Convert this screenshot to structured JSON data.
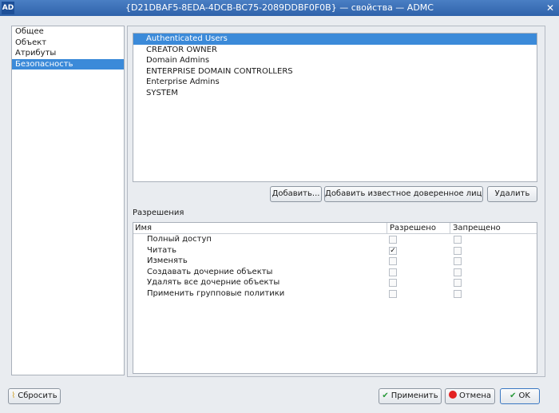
{
  "window": {
    "app_icon": "AD",
    "title": "{D21DBAF5-8EDA-4DCB-BC75-2089DDBF0F0B} — свойства — ADMC",
    "close_glyph": "✕"
  },
  "nav": {
    "items": [
      {
        "label": "Общее"
      },
      {
        "label": "Объект"
      },
      {
        "label": "Атрибуты"
      },
      {
        "label": "Безопасность",
        "selected": true
      }
    ]
  },
  "principals": {
    "items": [
      {
        "label": "Authenticated Users",
        "selected": true
      },
      {
        "label": "CREATOR OWNER"
      },
      {
        "label": "Domain Admins"
      },
      {
        "label": "ENTERPRISE DOMAIN CONTROLLERS"
      },
      {
        "label": "Enterprise Admins"
      },
      {
        "label": "SYSTEM"
      }
    ]
  },
  "principal_buttons": {
    "add": "Добавить...",
    "add_well_known": "Добавить известное доверенное лицо...",
    "remove": "Удалить"
  },
  "permissions": {
    "caption": "Разрешения",
    "headers": {
      "name": "Имя",
      "allowed": "Разрешено",
      "denied": "Запрещено"
    },
    "rows": [
      {
        "name": "Полный доступ",
        "allowed": false,
        "denied": false
      },
      {
        "name": "Читать",
        "allowed": true,
        "denied": false
      },
      {
        "name": "Изменять",
        "allowed": false,
        "denied": false
      },
      {
        "name": "Создавать дочерние объекты",
        "allowed": false,
        "denied": false
      },
      {
        "name": "Удалять все дочерние объекты",
        "allowed": false,
        "denied": false
      },
      {
        "name": "Применить групповые политики",
        "allowed": false,
        "denied": false
      }
    ]
  },
  "footer": {
    "reset": "Сбросить",
    "apply": "Применить",
    "cancel": "Отмена",
    "ok": "OK"
  },
  "colors": {
    "selection": "#3b8ad9",
    "titlebar": "#3a6fb8"
  }
}
